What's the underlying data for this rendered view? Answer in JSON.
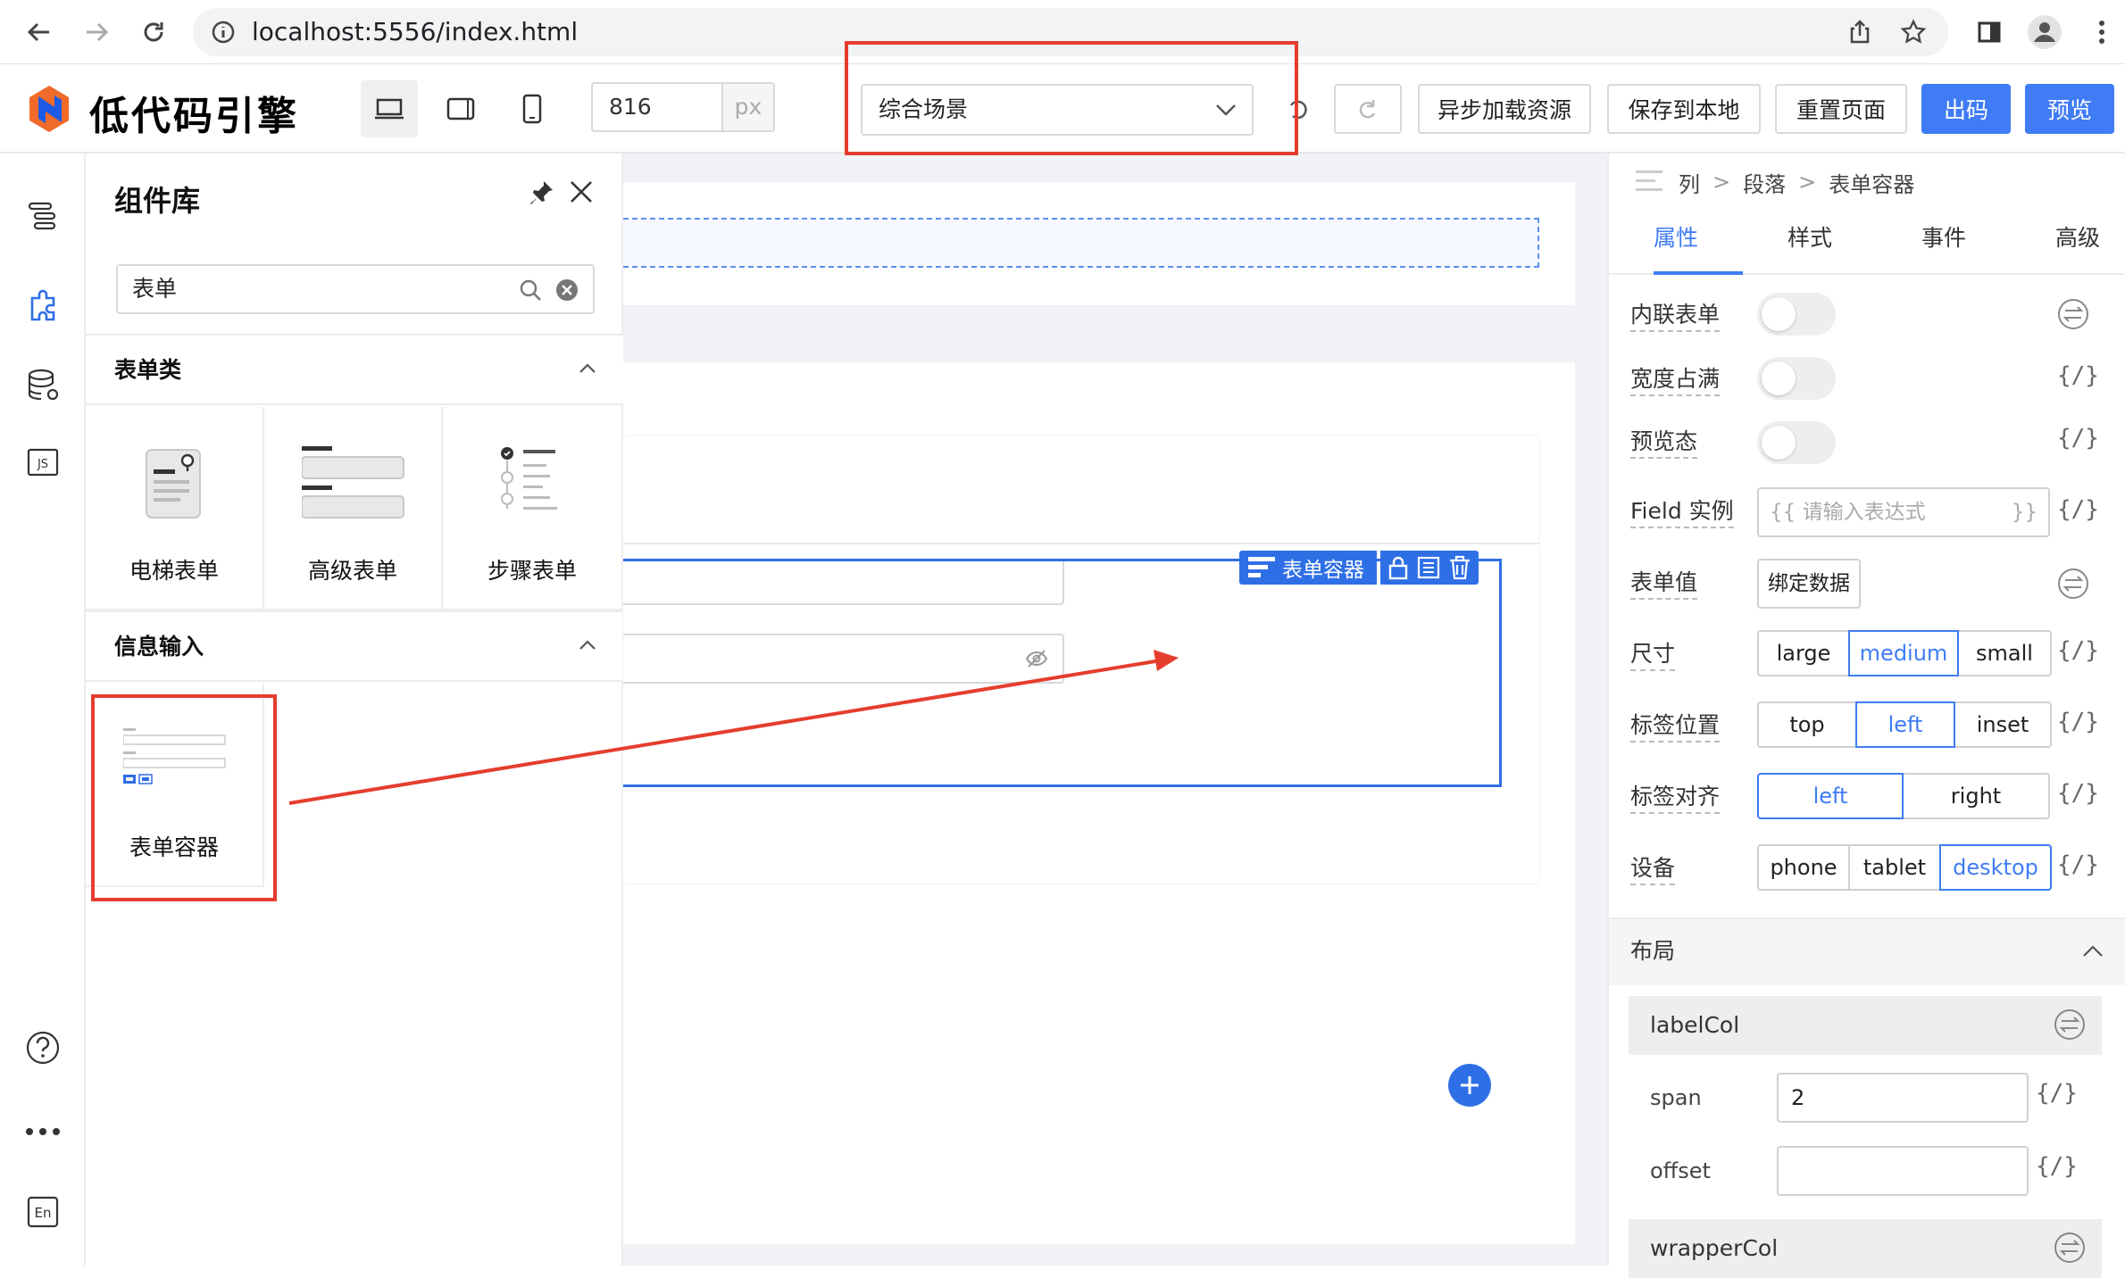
{
  "browser": {
    "url": "localhost:5556/index.html"
  },
  "toolbar": {
    "brand": "低代码引擎",
    "width_value": "816",
    "width_unit": "px",
    "scene": "综合场景",
    "buttons": {
      "async_load": "异步加载资源",
      "save_local": "保存到本地",
      "reset_page": "重置页面",
      "export": "出码",
      "preview": "预览"
    }
  },
  "panel": {
    "title": "组件库",
    "search_value": "表单",
    "groups": [
      {
        "title": "表单类",
        "items": [
          "电梯表单",
          "高级表单",
          "步骤表单"
        ]
      },
      {
        "title": "信息输入",
        "items": [
          "表单容器"
        ]
      }
    ]
  },
  "canvas": {
    "selected_component": "表单容器"
  },
  "props": {
    "breadcrumb": [
      "列",
      "段落",
      "表单容器"
    ],
    "tabs": [
      "属性",
      "样式",
      "事件",
      "高级"
    ],
    "active_tab": "属性",
    "rows": {
      "inline": "内联表单",
      "full_width": "宽度占满",
      "preview_state": "预览态",
      "field_instance": "Field 实例",
      "field_placeholder": "{{ 请输入表达式",
      "field_close": "}}",
      "form_value": "表单值",
      "bind_data": "绑定数据",
      "size": "尺寸",
      "label_position": "标签位置",
      "label_align": "标签对齐",
      "device": "设备"
    },
    "size_options": [
      "large",
      "medium",
      "small"
    ],
    "size_selected": "medium",
    "label_position_options": [
      "top",
      "left",
      "inset"
    ],
    "label_position_selected": "left",
    "label_align_options": [
      "left",
      "right"
    ],
    "label_align_selected": "left",
    "device_options": [
      "phone",
      "tablet",
      "desktop"
    ],
    "device_selected": "desktop",
    "expr_icon": "{/}",
    "layout": {
      "title": "布局",
      "label_col": "labelCol",
      "span_label": "span",
      "span_value": "2",
      "offset_label": "offset",
      "offset_value": "",
      "wrapper_col": "wrapperCol"
    }
  },
  "colors": {
    "accent": "#3f7cf5",
    "selection": "#2f6fe6",
    "annotation": "#e53d2d"
  }
}
